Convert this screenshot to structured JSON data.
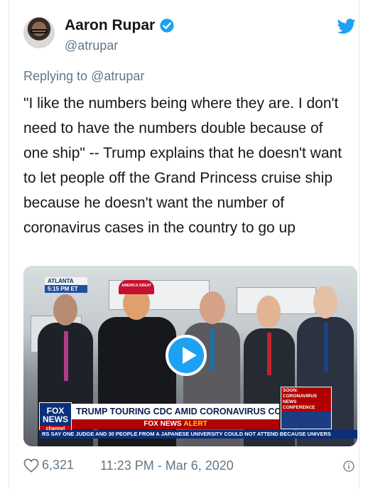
{
  "author": {
    "name": "Aaron Rupar",
    "handle": "@atrupar",
    "verified": true
  },
  "reply": {
    "prefix": "Replying to ",
    "to": "@atrupar"
  },
  "tweet": {
    "text": "\"I like the numbers being where they are. I don't need to have the numbers double because of one ship\" -- Trump explains that he doesn't want to let people off the Grand Princess cruise ship because he doesn't want the number of coronavirus cases in the country to go up"
  },
  "media": {
    "location": "ATLANTA",
    "time": "5:15 PM ET",
    "network_logo_line1": "FOX",
    "network_logo_line2": "NEWS",
    "network_logo_line3": "channel",
    "headline": "TRUMP TOURING CDC AMID CORONAVIRUS CONCERNS",
    "alert_prefix": "FOX NEWS",
    "alert_word": "ALERT",
    "side_label": "SOON: CORONAVIRUS NEWS CONFERENCE",
    "ticker": "RS SAY ONE JUDGE AND 30 PEOPLE FROM A JAPANESE UNIVERSITY COULD NOT ATTEND BECAUSE UNIVERS",
    "hat_text": "AMERICA GREAT"
  },
  "footer": {
    "likes": "6,321",
    "timestamp": "11:23 PM - Mar 6, 2020"
  },
  "colors": {
    "brand": "#1da1f2",
    "text": "#14171a",
    "muted": "#657786",
    "alert_red": "#b00000",
    "fox_blue": "#0a2f7a"
  },
  "icons": [
    "verified-badge-icon",
    "twitter-bird-icon",
    "play-icon",
    "heart-icon",
    "info-icon"
  ]
}
